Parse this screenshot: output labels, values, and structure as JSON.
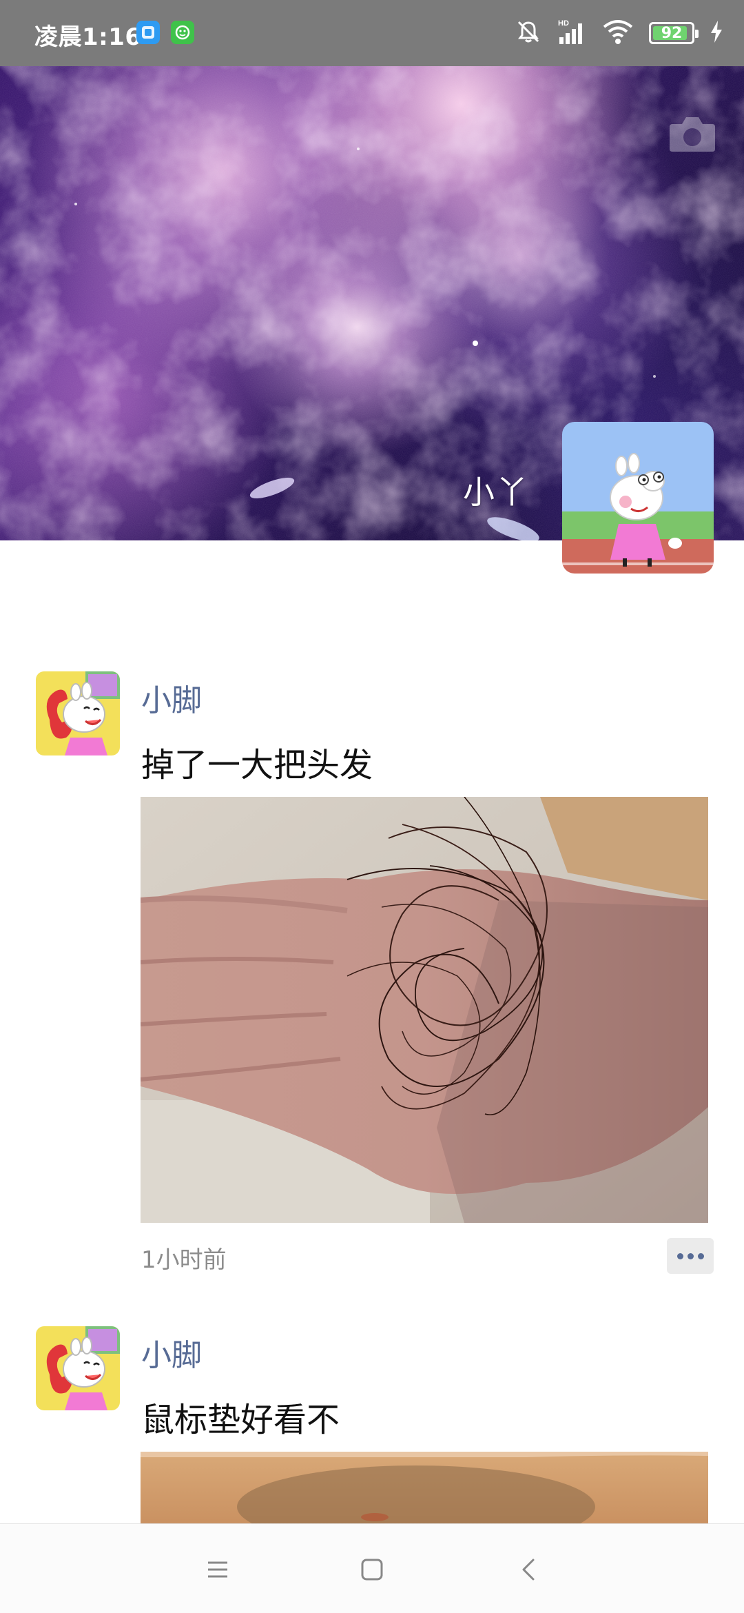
{
  "status_bar": {
    "time": "凌晨1:16",
    "battery": "92",
    "battery_level": 0.92,
    "icons": [
      "app-blue-icon",
      "app-green-icon",
      "mute-icon",
      "hd-signal-icon",
      "wifi-icon",
      "battery-icon",
      "charging-icon"
    ]
  },
  "profile": {
    "name": "小丫"
  },
  "posts": [
    {
      "author": "小脚",
      "text": "掉了一大把头发",
      "time": "1小时前"
    },
    {
      "author": "小脚",
      "text": "鼠标垫好看不"
    }
  ],
  "nav": {
    "icons": [
      "menu-icon",
      "home-icon",
      "back-icon"
    ]
  },
  "colors": {
    "author_link": "#576b95",
    "status_bar": "#7b7b7b",
    "battery_fill": "#6fd36f"
  }
}
